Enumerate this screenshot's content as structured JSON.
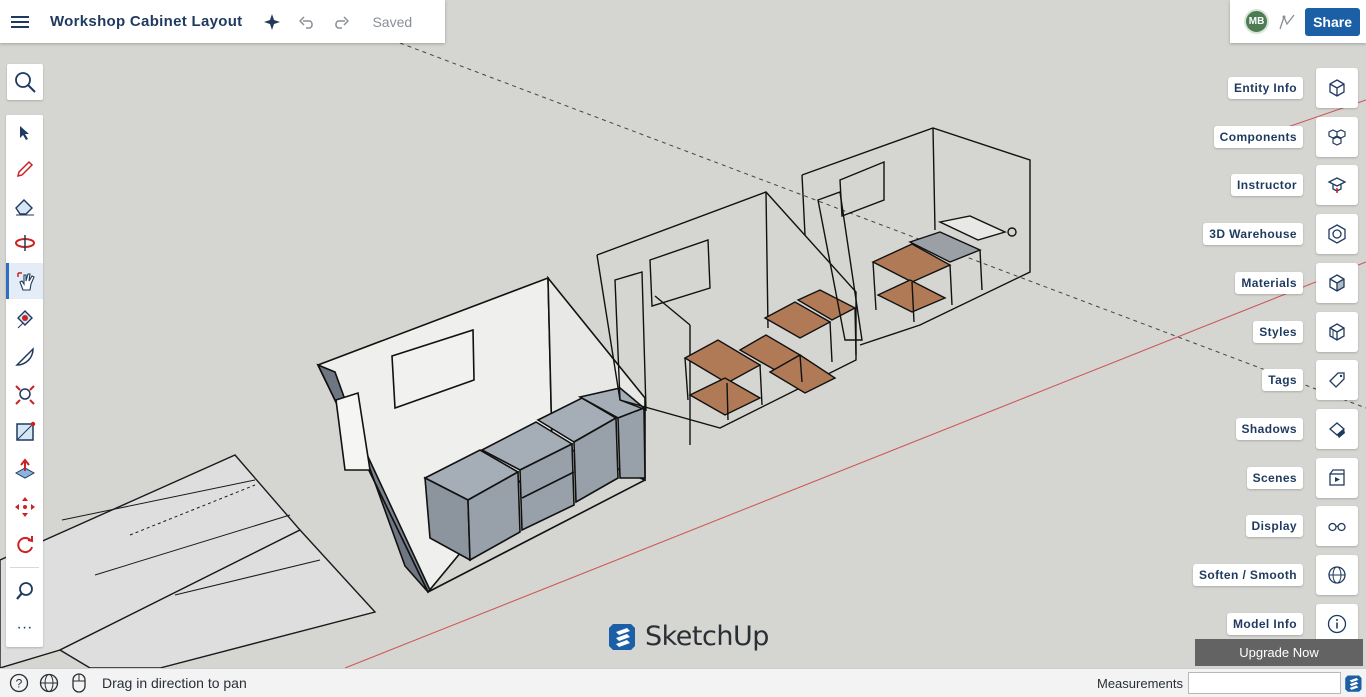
{
  "app": {
    "document_title": "Workshop Cabinet Layout",
    "save_status": "Saved",
    "brand_name": "SketchUp"
  },
  "header": {
    "avatar_initials": "MB",
    "share_label": "Share"
  },
  "toolbar": {
    "tools": [
      {
        "name": "select",
        "icon": "arrow-cursor-icon"
      },
      {
        "name": "pencil",
        "icon": "pencil-icon"
      },
      {
        "name": "eraser",
        "icon": "eraser-icon"
      },
      {
        "name": "orbit",
        "icon": "orbit-icon"
      },
      {
        "name": "pan",
        "icon": "hand-pan-icon",
        "active": true
      },
      {
        "name": "paint",
        "icon": "paint-bucket-icon"
      },
      {
        "name": "protractor",
        "icon": "protractor-icon"
      },
      {
        "name": "zoom-extents",
        "icon": "zoom-extents-icon"
      },
      {
        "name": "rectangle",
        "icon": "rectangle-icon"
      },
      {
        "name": "push-pull",
        "icon": "push-pull-icon"
      },
      {
        "name": "move",
        "icon": "move-icon"
      },
      {
        "name": "rotate",
        "icon": "rotate-icon"
      },
      {
        "name": "zoom",
        "icon": "zoom-icon"
      },
      {
        "name": "more",
        "icon": "more-icon"
      }
    ],
    "more_label": "···"
  },
  "panels": [
    {
      "label": "Entity Info",
      "icon": "entity-info-icon"
    },
    {
      "label": "Components",
      "icon": "components-icon"
    },
    {
      "label": "Instructor",
      "icon": "instructor-icon"
    },
    {
      "label": "3D Warehouse",
      "icon": "warehouse-icon"
    },
    {
      "label": "Materials",
      "icon": "materials-icon"
    },
    {
      "label": "Styles",
      "icon": "styles-icon"
    },
    {
      "label": "Tags",
      "icon": "tag-icon"
    },
    {
      "label": "Shadows",
      "icon": "shadows-icon"
    },
    {
      "label": "Scenes",
      "icon": "scenes-icon"
    },
    {
      "label": "Display",
      "icon": "glasses-icon"
    },
    {
      "label": "Soften / Smooth",
      "icon": "soften-icon"
    },
    {
      "label": "Model Info",
      "icon": "info-icon"
    }
  ],
  "upgrade_label": "Upgrade Now",
  "status": {
    "message": "Drag in direction to pan",
    "measurements_label": "Measurements",
    "measurements_value": ""
  },
  "colors": {
    "accent": "#1b5fa6",
    "title": "#1f3a5f",
    "wood": "#b07a57",
    "cabinet": "#9aa3ab",
    "axis_red": "#cc4444",
    "viewport": "#d5d5d1"
  }
}
